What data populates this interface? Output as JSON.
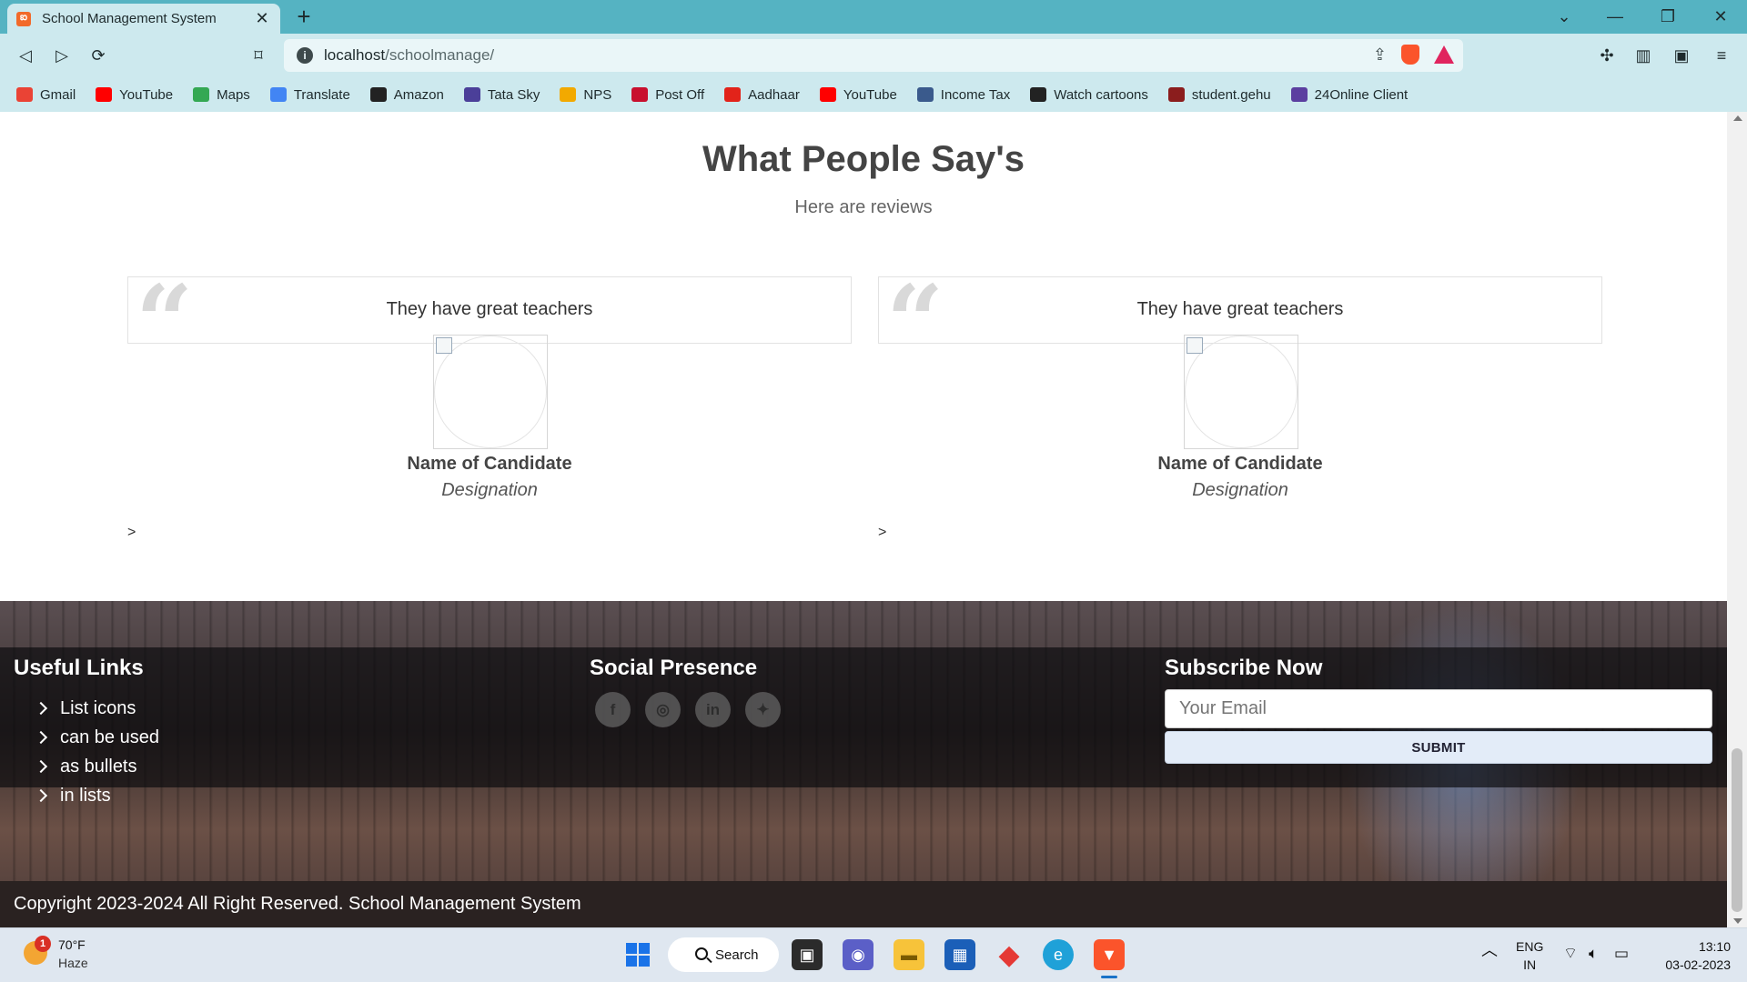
{
  "browser": {
    "tab_title": "School Management System",
    "tab_favicon": "xampp-icon",
    "url_host": "localhost",
    "url_path": "/schoolmanage/",
    "bookmarks": [
      {
        "label": "Gmail",
        "icon": "gmail-icon",
        "color": "#ea4335"
      },
      {
        "label": "YouTube",
        "icon": "youtube-icon",
        "color": "#ff0000"
      },
      {
        "label": "Maps",
        "icon": "maps-icon",
        "color": "#34a853"
      },
      {
        "label": "Translate",
        "icon": "translate-icon",
        "color": "#4285f4"
      },
      {
        "label": "Amazon",
        "icon": "amazon-icon",
        "color": "#222222"
      },
      {
        "label": "Tata Sky",
        "icon": "tatasky-icon",
        "color": "#4b3f99"
      },
      {
        "label": "NPS",
        "icon": "nps-icon",
        "color": "#f2a900"
      },
      {
        "label": "Post Off",
        "icon": "postoffice-icon",
        "color": "#c8102e"
      },
      {
        "label": "Aadhaar",
        "icon": "aadhaar-icon",
        "color": "#e2231a"
      },
      {
        "label": "YouTube",
        "icon": "youtube-icon",
        "color": "#ff0000"
      },
      {
        "label": "Income Tax",
        "icon": "incometax-icon",
        "color": "#3a5a8c"
      },
      {
        "label": "Watch cartoons",
        "icon": "globe-icon",
        "color": "#222222"
      },
      {
        "label": "student.gehu",
        "icon": "gehu-icon",
        "color": "#8b1d1d"
      },
      {
        "label": "24Online Client",
        "icon": "24online-icon",
        "color": "#5b3fa0"
      }
    ]
  },
  "reviews": {
    "title": "What People Say's",
    "subtitle": "Here are reviews",
    "cards": [
      {
        "quote": "They have great teachers",
        "name": "Name of Candidate",
        "designation": "Designation",
        "next": ">"
      },
      {
        "quote": "They have great teachers",
        "name": "Name of Candidate",
        "designation": "Designation",
        "next": ">"
      }
    ]
  },
  "footer": {
    "useful_links_title": "Useful Links",
    "links": [
      "List icons",
      "can be used",
      "as bullets",
      "in lists"
    ],
    "social_title": "Social Presence",
    "socials": [
      {
        "icon": "facebook-icon",
        "glyph": "f"
      },
      {
        "icon": "instagram-icon",
        "glyph": "◎"
      },
      {
        "icon": "linkedin-icon",
        "glyph": "in"
      },
      {
        "icon": "twitter-icon",
        "glyph": "✦"
      }
    ],
    "subscribe_title": "Subscribe Now",
    "email_placeholder": "Your Email",
    "submit_label": "SUBMIT",
    "copyright": "Copyright 2023-2024 All Right Reserved. School Management System"
  },
  "taskbar": {
    "weather_temp": "70°F",
    "weather_cond": "Haze",
    "weather_badge": "1",
    "search_label": "Search",
    "lang_top": "ENG",
    "lang_bottom": "IN",
    "time": "13:10",
    "date": "03-02-2023"
  }
}
